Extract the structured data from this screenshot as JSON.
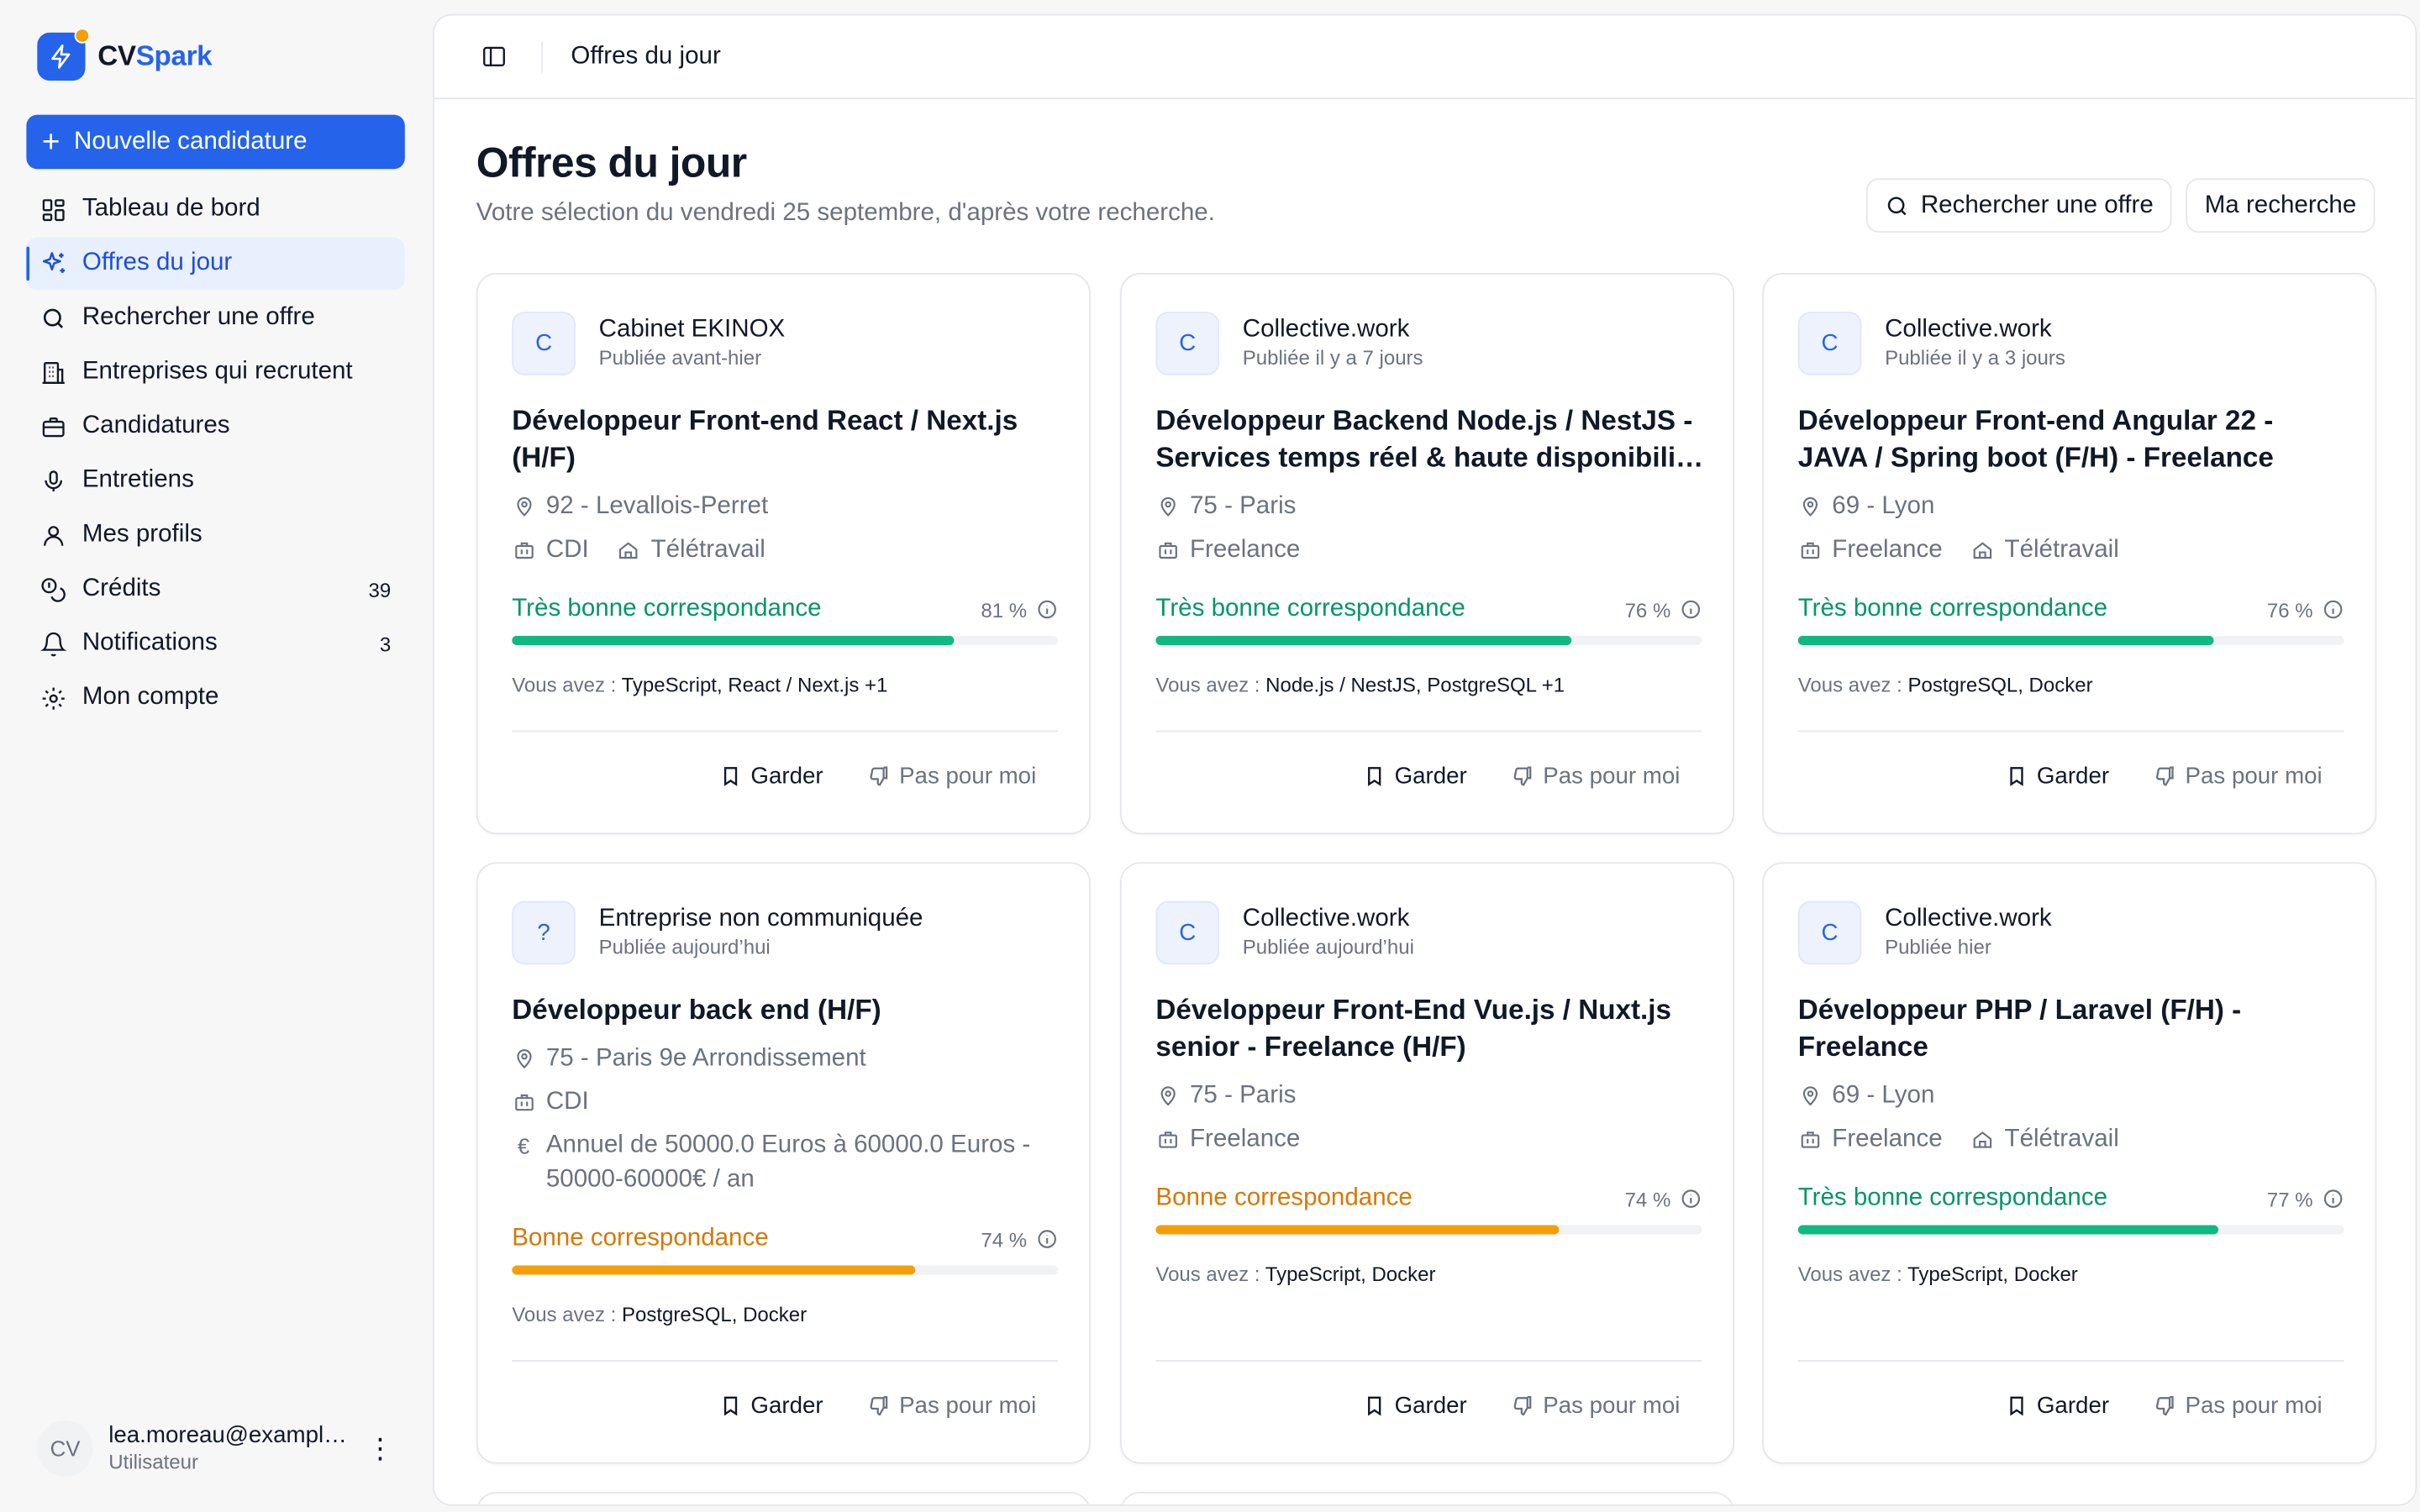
{
  "app": {
    "logo_cv": "CV",
    "logo_spark": "Spark",
    "brand_color": "#2563eb"
  },
  "sidebar": {
    "new_button": "Nouvelle candidature",
    "items": [
      {
        "label": "Tableau de bord",
        "icon": "dashboard-icon",
        "count": ""
      },
      {
        "label": "Offres du jour",
        "icon": "sparkles-icon",
        "count": "",
        "active": true
      },
      {
        "label": "Rechercher une offre",
        "icon": "search-icon",
        "count": ""
      },
      {
        "label": "Entreprises qui recrutent",
        "icon": "building-icon",
        "count": ""
      },
      {
        "label": "Candidatures",
        "icon": "briefcase-icon",
        "count": ""
      },
      {
        "label": "Entretiens",
        "icon": "microphone-icon",
        "count": ""
      },
      {
        "label": "Mes profils",
        "icon": "user-icon",
        "count": ""
      },
      {
        "label": "Crédits",
        "icon": "coins-icon",
        "count": "39"
      },
      {
        "label": "Notifications",
        "icon": "bell-icon",
        "count": "3"
      },
      {
        "label": "Mon compte",
        "icon": "gear-icon",
        "count": ""
      }
    ],
    "user": {
      "initials": "CV",
      "email": "lea.moreau@example.com",
      "role": "Utilisateur"
    }
  },
  "topbar": {
    "breadcrumb": "Offres du jour"
  },
  "page": {
    "title": "Offres du jour",
    "subtitle": "Votre sélection du vendredi 25 septembre, d'après votre recherche.",
    "search_button": "Rechercher une offre",
    "my_search_button": "Ma recherche"
  },
  "labels": {
    "you_have": "Vous avez :",
    "keep": "Garder",
    "not_for_me": "Pas pour moi"
  },
  "colors": {
    "good_match": "#10b981",
    "good_match_text": "#059669",
    "ok_match": "#f59e0b",
    "ok_match_text": "#d97706"
  },
  "offers": [
    {
      "company_initial": "C",
      "company": "Cabinet EKINOX",
      "posted": "Publiée avant-hier",
      "title": "Développeur Front-end React / Next.js (H/F)",
      "location": "92 - Levallois-Perret",
      "contract": "CDI",
      "remote": "Télétravail",
      "salary": "",
      "match_label": "Très bonne correspondance",
      "match_level": "high",
      "match_pct": 81,
      "match_pct_text": "81 %",
      "skills": "TypeScript, React / Next.js +1"
    },
    {
      "company_initial": "C",
      "company": "Collective.work",
      "posted": "Publiée il y a 7 jours",
      "title": "Développeur Backend Node.js / NestJS - Services temps réel & haute disponibilité - Freelance (H/F)",
      "location": "75 - Paris",
      "contract": "Freelance",
      "remote": "",
      "salary": "",
      "match_label": "Très bonne correspondance",
      "match_level": "high",
      "match_pct": 76,
      "match_pct_text": "76 %",
      "skills": "Node.js / NestJS, PostgreSQL +1"
    },
    {
      "company_initial": "C",
      "company": "Collective.work",
      "posted": "Publiée il y a 3 jours",
      "title": "Développeur Front-end Angular 22 - JAVA / Spring boot (F/H) - Freelance",
      "location": "69 - Lyon",
      "contract": "Freelance",
      "remote": "Télétravail",
      "salary": "",
      "match_label": "Très bonne correspondance",
      "match_level": "high",
      "match_pct": 76,
      "match_pct_text": "76 %",
      "skills": "PostgreSQL, Docker"
    },
    {
      "company_initial": "?",
      "company": "Entreprise non communiquée",
      "posted": "Publiée aujourd’hui",
      "title": "Développeur back end (H/F)",
      "location": "75 - Paris 9e Arrondissement",
      "contract": "CDI",
      "remote": "",
      "salary": "Annuel de 50000.0 Euros à 60000.0 Euros - 50000-60000€ / an",
      "match_label": "Bonne correspondance",
      "match_level": "medium",
      "match_pct": 74,
      "match_pct_text": "74 %",
      "skills": "PostgreSQL, Docker"
    },
    {
      "company_initial": "C",
      "company": "Collective.work",
      "posted": "Publiée aujourd’hui",
      "title": "Développeur Front-End Vue.js / Nuxt.js senior - Freelance (H/F)",
      "location": "75 - Paris",
      "contract": "Freelance",
      "remote": "",
      "salary": "",
      "match_label": "Bonne correspondance",
      "match_level": "medium",
      "match_pct": 74,
      "match_pct_text": "74 %",
      "skills": "TypeScript, Docker"
    },
    {
      "company_initial": "C",
      "company": "Collective.work",
      "posted": "Publiée hier",
      "title": "Développeur PHP / Laravel (F/H) - Freelance",
      "location": "69 - Lyon",
      "contract": "Freelance",
      "remote": "Télétravail",
      "salary": "",
      "match_label": "Très bonne correspondance",
      "match_level": "high",
      "match_pct": 77,
      "match_pct_text": "77 %",
      "skills": "TypeScript, Docker"
    }
  ]
}
